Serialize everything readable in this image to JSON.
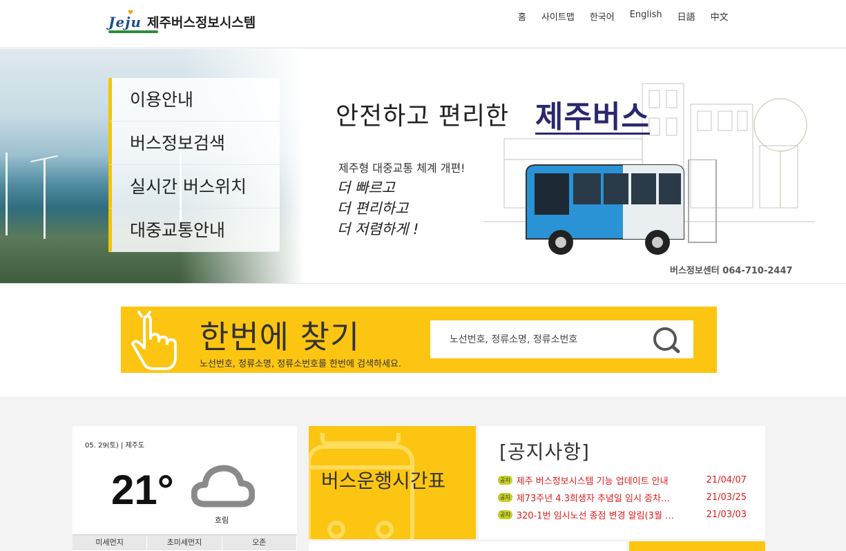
{
  "header": {
    "logo_mark": "Jeju",
    "logo_text": "제주버스정보시스템",
    "nav": [
      "홈",
      "사이트맵",
      "한국어",
      "English",
      "日語",
      "中文"
    ]
  },
  "hero": {
    "menu": [
      "이용안내",
      "버스정보검색",
      "실시간 버스위치",
      "대중교통안내"
    ],
    "banner_title": "안전하고 편리한",
    "banner_brand": "제주버스",
    "banner_sub": "제주형 대중교통 체계 개편!",
    "banner_lines": [
      "더 빠르고",
      "더 편리하고",
      "더 저렴하게 !"
    ],
    "phone": "버스정보센터 064-710-2447"
  },
  "search": {
    "title": "한번에 찾기",
    "description": "노선번호, 정류소명, 정류소번호를 한번에 검색하세요.",
    "placeholder": "노선번호, 정류소명, 정류소번호"
  },
  "weather": {
    "date": "05. 29(토)  |  제주도",
    "temperature": "21°",
    "condition": "흐림",
    "table_headers": [
      "미세먼지",
      "초미세먼지",
      "오존"
    ]
  },
  "timetable": {
    "label": "버스운행시간표"
  },
  "notice": {
    "title": "[공지사항]",
    "badge": "공지",
    "items": [
      {
        "text": "제주 버스정보시스템 기능 업데이트 안내",
        "date": "21/04/07"
      },
      {
        "text": "제73주년 4.3희생자 추념일 임시 증차…",
        "date": "21/03/25"
      },
      {
        "text": "320-1번 임시노선 종점 변경 알림(3월 …",
        "date": "21/03/03"
      }
    ]
  },
  "colors": {
    "accent_yellow": "#fcc512",
    "brand_navy": "#2a2770",
    "notice_red": "#e21b1b"
  }
}
